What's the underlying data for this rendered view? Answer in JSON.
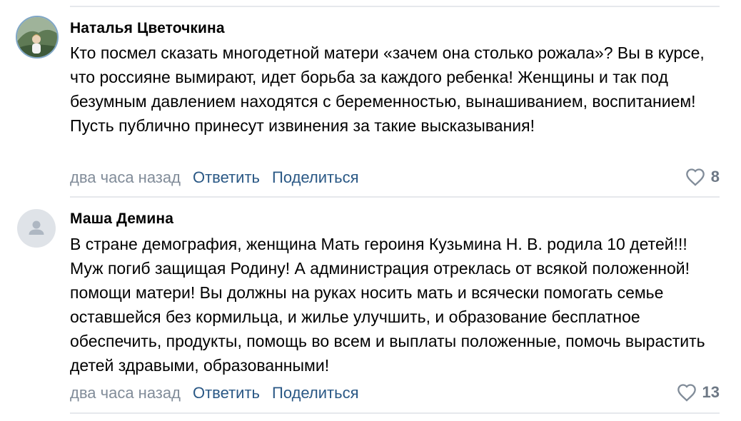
{
  "comments": [
    {
      "author": "Наталья Цветочкина",
      "avatar": "user-photo",
      "text": "Кто посмел сказать многодетной матери «зачем она столько рожала»? Вы в курсе, что россияне вымирают, идет борьба за каждого ребенка! Женщины и так под безумным давлением находятся с беременностью, вынашиванием, воспитанием! Пусть публично принесут извинения за такие высказывания!",
      "time": "два часа назад",
      "reply_label": "Ответить",
      "share_label": "Поделиться",
      "likes": "8",
      "like_icon": "heart-icon"
    },
    {
      "author": "Маша Демина",
      "avatar": "default-user-icon",
      "text": "В стране демография, женщина Мать героиня Кузьмина Н. В. родила 10 детей!!! Муж погиб защищая Родину! А администрация отреклась от всякой положенной! помощи матери! Вы должны на руках носить мать и всячески помогать семье оставшейся без кормильца, и жилье улучшить, и образование бесплатное обеспечить, продукты, помощь во всем и выплаты положенные, помочь вырастить детей здравыми, образованными!",
      "time": "два часа назад",
      "reply_label": "Ответить",
      "share_label": "Поделиться",
      "likes": "13",
      "like_icon": "heart-icon"
    }
  ],
  "colors": {
    "link": "#2a5885",
    "meta": "#818c99",
    "likes": "#6d7885",
    "divider": "#e6e8ec",
    "avatar_placeholder": "#dfe3e8"
  }
}
